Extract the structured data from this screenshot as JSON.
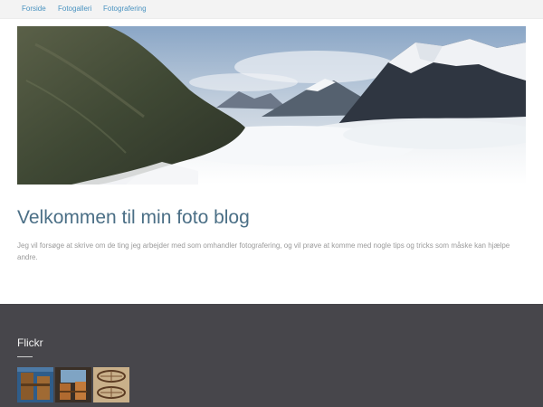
{
  "nav": {
    "items": [
      {
        "label": "Forside"
      },
      {
        "label": "Fotogalleri"
      },
      {
        "label": "Fotografering"
      }
    ]
  },
  "hero": {
    "image": "mountain-clouds-landscape"
  },
  "post": {
    "title": "Velkommen til min foto blog",
    "intro": "Jeg vil forsøge at skrive om de ting jeg arbejder med som omhandler fotografering, og vil prøve at komme med nogle tips og tricks som måske kan hjælpe andre."
  },
  "footer": {
    "widget_title": "Flickr",
    "thumbnails": [
      {
        "subject": "wooden-chairs-photo"
      },
      {
        "subject": "chairs-window-photo"
      },
      {
        "subject": "baskets-photo"
      }
    ]
  },
  "colors": {
    "nav_link": "#4a93c0",
    "title": "#4b6f86",
    "footer_bg": "#47464b"
  }
}
